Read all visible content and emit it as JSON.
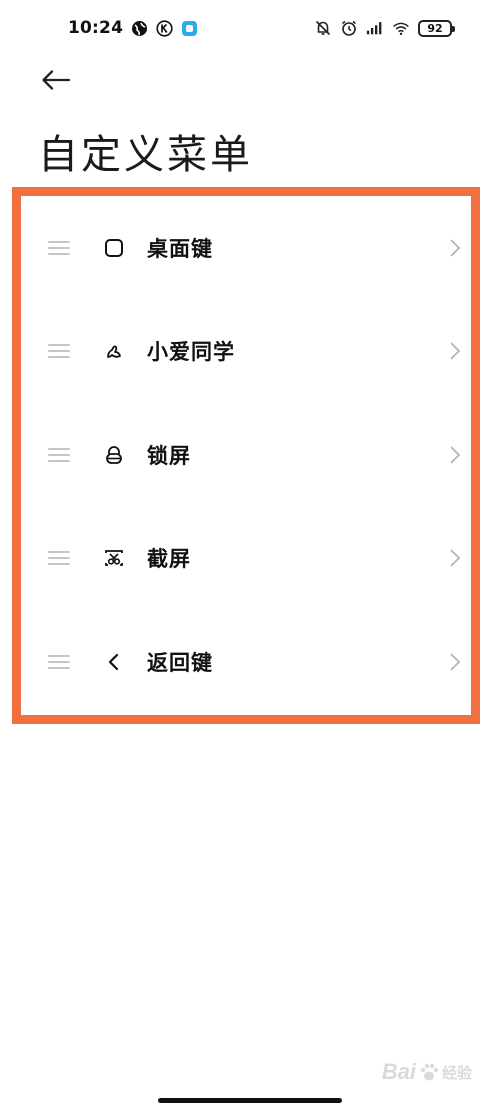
{
  "status_bar": {
    "time": "10:24",
    "battery": "92",
    "left_icons": [
      "globe-icon",
      "k-circle-icon",
      "app-square-icon"
    ],
    "right_icons": [
      "mute-bell-icon",
      "alarm-icon",
      "signal-icon",
      "wifi-icon",
      "battery-icon"
    ]
  },
  "header": {
    "back_icon": "arrow-left-icon",
    "title": "自定义菜单"
  },
  "menu": {
    "items": [
      {
        "icon": "square-outline-icon",
        "label": "桌面键"
      },
      {
        "icon": "xiaoai-icon",
        "label": "小爱同学"
      },
      {
        "icon": "lock-icon",
        "label": "锁屏"
      },
      {
        "icon": "screenshot-scissors-icon",
        "label": "截屏"
      },
      {
        "icon": "chevron-left-icon",
        "label": "返回键"
      }
    ]
  },
  "watermark": {
    "brand": "Bai",
    "brand_tail": "经验"
  },
  "colors": {
    "highlight": "#f26f3f",
    "handle": "#c6c6c6",
    "chevron": "#b5b5b5"
  }
}
